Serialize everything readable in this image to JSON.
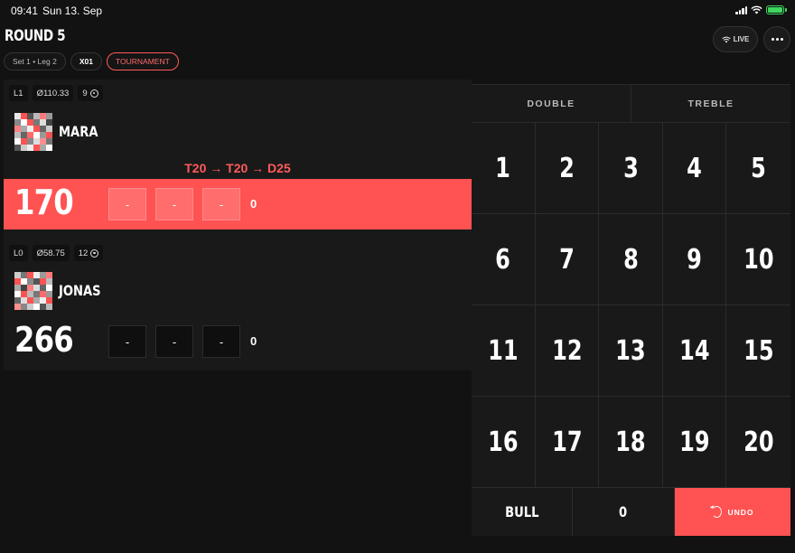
{
  "status": {
    "time": "09:41",
    "date": "Sun 13. Sep"
  },
  "header": {
    "title": "ROUND 5",
    "chips": [
      "Set 1 • Leg 2",
      "X01",
      "TOURNAMENT"
    ],
    "live_label": "LIVE"
  },
  "players": [
    {
      "legs": "L1",
      "average": "Ø110.33",
      "darts": "9",
      "name": "MARA",
      "score": "170",
      "checkout_hint": "T20 → T20 → D25",
      "throws": [
        "-",
        "-",
        "-"
      ],
      "turn_total": "0",
      "active": true
    },
    {
      "legs": "L0",
      "average": "Ø58.75",
      "darts": "12",
      "name": "JONAS",
      "score": "266",
      "throws": [
        "-",
        "-",
        "-"
      ],
      "turn_total": "0",
      "active": false
    }
  ],
  "keypad": {
    "modifiers": [
      "DOUBLE",
      "TREBLE"
    ],
    "numbers": [
      "1",
      "2",
      "3",
      "4",
      "5",
      "6",
      "7",
      "8",
      "9",
      "10",
      "11",
      "12",
      "13",
      "14",
      "15",
      "16",
      "17",
      "18",
      "19",
      "20"
    ],
    "bull_label": "BULL",
    "zero_label": "0",
    "undo_label": "UNDO"
  },
  "colors": {
    "accent": "#ff5252",
    "background": "#121212",
    "panel": "#191919"
  },
  "icons": [
    "signal-icon",
    "wifi-icon",
    "battery-icon",
    "target-icon",
    "more-icon",
    "undo-icon"
  ]
}
